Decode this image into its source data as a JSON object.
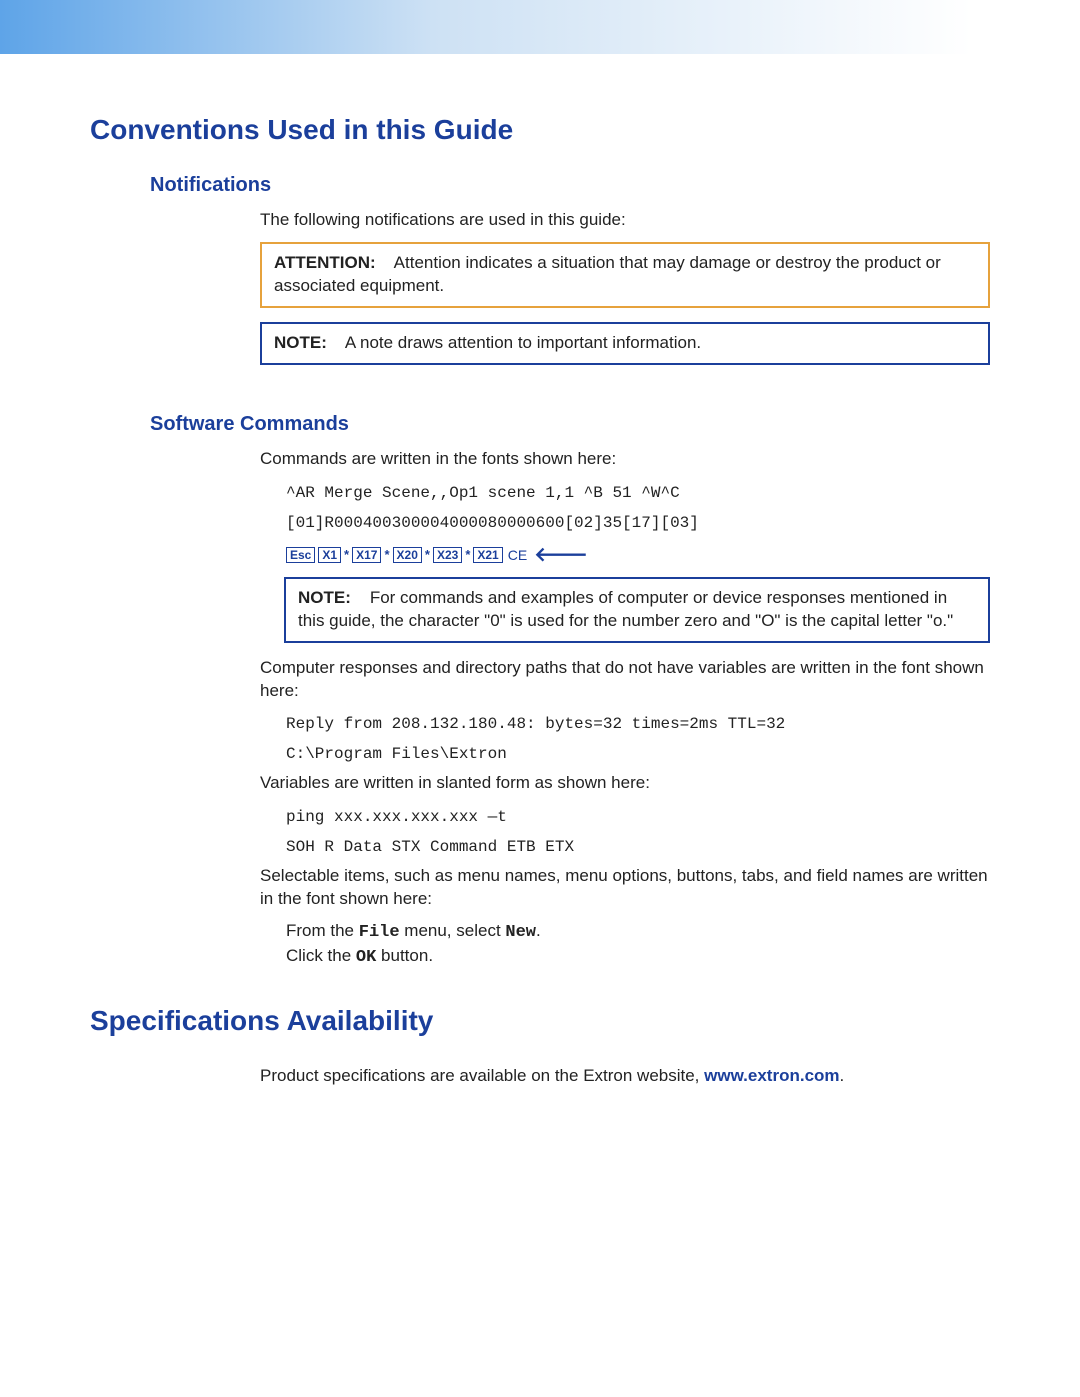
{
  "h1_conventions": "Conventions Used in this Guide",
  "h2_notifications": "Notifications",
  "notifications_intro": "The following notifications are used in this guide:",
  "attention_label": "ATTENTION:",
  "attention_text": "Attention indicates a situation that may damage or destroy the product or associated equipment.",
  "note_label": "NOTE:",
  "note1_text": "A note draws attention to important information.",
  "h2_software": "Software Commands",
  "software_intro": "Commands are written in the fonts shown here:",
  "cmd_line1": "^AR Merge Scene,,Op1 scene 1,1 ^B 51 ^W^C",
  "cmd_line2": "[01]R000400300004000080000600[02]35[17][03]",
  "key_esc": "Esc",
  "key_x1": "X1",
  "key_x17": "X17",
  "key_x20": "X20",
  "key_x23": "X23",
  "key_x21": "X21",
  "key_ce": "CE",
  "note2_text": "For commands and examples of computer or device responses mentioned in this guide, the character \"0\" is used for the number zero and \"O\" is the capital letter \"o.\"",
  "responses_intro": "Computer responses and directory paths that do not have variables are written in the font shown here:",
  "resp_line1": "Reply from 208.132.180.48: bytes=32 times=2ms TTL=32",
  "resp_line2": "C:\\Program Files\\Extron",
  "variables_intro": "Variables are written in slanted form as shown here:",
  "var_line1": "ping xxx.xxx.xxx.xxx —t",
  "var_line2": "SOH R Data STX Command ETB ETX",
  "selectable_intro": "Selectable items, such as menu names, menu options, buttons, tabs, and field names are written in the font shown here:",
  "ui_from": "From the ",
  "ui_file": "File",
  "ui_menu_select": " menu, select ",
  "ui_new": "New",
  "ui_period": ".",
  "ui_click": "Click the ",
  "ui_ok": "OK",
  "ui_button": " button.",
  "h1_specs": "Specifications Availability",
  "specs_text_pre": "Product specifications are available on the Extron website, ",
  "specs_link": "www.extron.com",
  "specs_text_post": "."
}
